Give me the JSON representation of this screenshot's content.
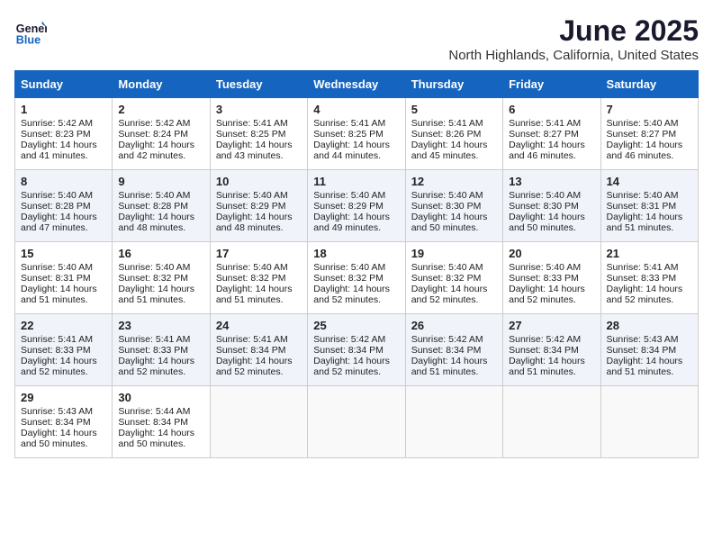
{
  "header": {
    "logo_line1": "General",
    "logo_line2": "Blue",
    "title": "June 2025",
    "subtitle": "North Highlands, California, United States"
  },
  "days_of_week": [
    "Sunday",
    "Monday",
    "Tuesday",
    "Wednesday",
    "Thursday",
    "Friday",
    "Saturday"
  ],
  "weeks": [
    [
      {
        "day": "1",
        "sunrise": "5:42 AM",
        "sunset": "8:23 PM",
        "daylight": "14 hours and 41 minutes."
      },
      {
        "day": "2",
        "sunrise": "5:42 AM",
        "sunset": "8:24 PM",
        "daylight": "14 hours and 42 minutes."
      },
      {
        "day": "3",
        "sunrise": "5:41 AM",
        "sunset": "8:25 PM",
        "daylight": "14 hours and 43 minutes."
      },
      {
        "day": "4",
        "sunrise": "5:41 AM",
        "sunset": "8:25 PM",
        "daylight": "14 hours and 44 minutes."
      },
      {
        "day": "5",
        "sunrise": "5:41 AM",
        "sunset": "8:26 PM",
        "daylight": "14 hours and 45 minutes."
      },
      {
        "day": "6",
        "sunrise": "5:41 AM",
        "sunset": "8:27 PM",
        "daylight": "14 hours and 46 minutes."
      },
      {
        "day": "7",
        "sunrise": "5:40 AM",
        "sunset": "8:27 PM",
        "daylight": "14 hours and 46 minutes."
      }
    ],
    [
      {
        "day": "8",
        "sunrise": "5:40 AM",
        "sunset": "8:28 PM",
        "daylight": "14 hours and 47 minutes."
      },
      {
        "day": "9",
        "sunrise": "5:40 AM",
        "sunset": "8:28 PM",
        "daylight": "14 hours and 48 minutes."
      },
      {
        "day": "10",
        "sunrise": "5:40 AM",
        "sunset": "8:29 PM",
        "daylight": "14 hours and 48 minutes."
      },
      {
        "day": "11",
        "sunrise": "5:40 AM",
        "sunset": "8:29 PM",
        "daylight": "14 hours and 49 minutes."
      },
      {
        "day": "12",
        "sunrise": "5:40 AM",
        "sunset": "8:30 PM",
        "daylight": "14 hours and 50 minutes."
      },
      {
        "day": "13",
        "sunrise": "5:40 AM",
        "sunset": "8:30 PM",
        "daylight": "14 hours and 50 minutes."
      },
      {
        "day": "14",
        "sunrise": "5:40 AM",
        "sunset": "8:31 PM",
        "daylight": "14 hours and 51 minutes."
      }
    ],
    [
      {
        "day": "15",
        "sunrise": "5:40 AM",
        "sunset": "8:31 PM",
        "daylight": "14 hours and 51 minutes."
      },
      {
        "day": "16",
        "sunrise": "5:40 AM",
        "sunset": "8:32 PM",
        "daylight": "14 hours and 51 minutes."
      },
      {
        "day": "17",
        "sunrise": "5:40 AM",
        "sunset": "8:32 PM",
        "daylight": "14 hours and 51 minutes."
      },
      {
        "day": "18",
        "sunrise": "5:40 AM",
        "sunset": "8:32 PM",
        "daylight": "14 hours and 52 minutes."
      },
      {
        "day": "19",
        "sunrise": "5:40 AM",
        "sunset": "8:32 PM",
        "daylight": "14 hours and 52 minutes."
      },
      {
        "day": "20",
        "sunrise": "5:40 AM",
        "sunset": "8:33 PM",
        "daylight": "14 hours and 52 minutes."
      },
      {
        "day": "21",
        "sunrise": "5:41 AM",
        "sunset": "8:33 PM",
        "daylight": "14 hours and 52 minutes."
      }
    ],
    [
      {
        "day": "22",
        "sunrise": "5:41 AM",
        "sunset": "8:33 PM",
        "daylight": "14 hours and 52 minutes."
      },
      {
        "day": "23",
        "sunrise": "5:41 AM",
        "sunset": "8:33 PM",
        "daylight": "14 hours and 52 minutes."
      },
      {
        "day": "24",
        "sunrise": "5:41 AM",
        "sunset": "8:34 PM",
        "daylight": "14 hours and 52 minutes."
      },
      {
        "day": "25",
        "sunrise": "5:42 AM",
        "sunset": "8:34 PM",
        "daylight": "14 hours and 52 minutes."
      },
      {
        "day": "26",
        "sunrise": "5:42 AM",
        "sunset": "8:34 PM",
        "daylight": "14 hours and 51 minutes."
      },
      {
        "day": "27",
        "sunrise": "5:42 AM",
        "sunset": "8:34 PM",
        "daylight": "14 hours and 51 minutes."
      },
      {
        "day": "28",
        "sunrise": "5:43 AM",
        "sunset": "8:34 PM",
        "daylight": "14 hours and 51 minutes."
      }
    ],
    [
      {
        "day": "29",
        "sunrise": "5:43 AM",
        "sunset": "8:34 PM",
        "daylight": "14 hours and 50 minutes."
      },
      {
        "day": "30",
        "sunrise": "5:44 AM",
        "sunset": "8:34 PM",
        "daylight": "14 hours and 50 minutes."
      },
      null,
      null,
      null,
      null,
      null
    ]
  ]
}
